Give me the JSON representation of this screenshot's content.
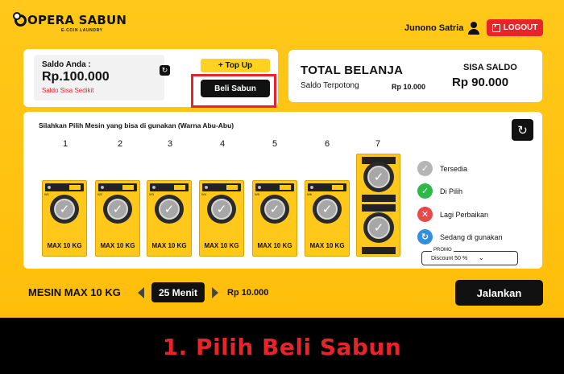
{
  "header": {
    "logo_text": "OPERA SABUN",
    "logo_sub": "E-COIN LAUNDRY",
    "username": "Junono Satria",
    "logout_label": "LOGOUT"
  },
  "saldo": {
    "label": "Saldo Anda :",
    "value": "Rp.100.000",
    "warning": "Saldo Sisa Sedikit",
    "refresh_icon": "↻"
  },
  "actions": {
    "topup_label": "+ Top Up",
    "beli_label": "Beli Sabun"
  },
  "total": {
    "title": "TOTAL BELANJA",
    "terpotong_label": "Saldo Terpotong",
    "terpotong_value": "Rp 10.000",
    "sisa_label": "SISA SALDO",
    "sisa_value": "Rp 90.000"
  },
  "panel": {
    "title": "Silahkan Pilih Mesin yang bisa di gunakan (Warna Abu-Abu)",
    "refresh_icon": "↻",
    "machines": [
      {
        "number": "1",
        "id": "W1",
        "capacity": "MAX 10 KG"
      },
      {
        "number": "2",
        "id": "W2",
        "capacity": "MAX 10 KG"
      },
      {
        "number": "3",
        "id": "W3",
        "capacity": "MAX 10 KG"
      },
      {
        "number": "4",
        "id": "W4",
        "capacity": "MAX 10 KG"
      },
      {
        "number": "5",
        "id": "W5",
        "capacity": "MAX 10 KG"
      },
      {
        "number": "6",
        "id": "W6",
        "capacity": "MAX 10 KG"
      },
      {
        "number": "7",
        "id": "T1/T2",
        "capacity": ""
      }
    ],
    "legend": [
      {
        "label": "Tersedia",
        "color": "#b5b5b5",
        "icon": "check-icon"
      },
      {
        "label": "Di Pilih",
        "color": "#2eb84a",
        "icon": "check-icon"
      },
      {
        "label": "Lagi Perbaikan",
        "color": "#e84a4a",
        "icon": "x-icon"
      },
      {
        "label": "Sedang di gunakan",
        "color": "#2f8fe0",
        "icon": "refresh-icon"
      }
    ],
    "promo": {
      "label": "PROMO",
      "value": "Discount 50 %"
    }
  },
  "bottom": {
    "machine_label": "MESIN MAX 10 KG",
    "duration": "25 Menit",
    "price": "Rp 10.000",
    "run_label": "Jalankan"
  },
  "caption": "1. Pilih Beli Sabun",
  "colors": {
    "background": "#ffc81a",
    "accent_red": "#e8242a",
    "dark": "#111111"
  }
}
